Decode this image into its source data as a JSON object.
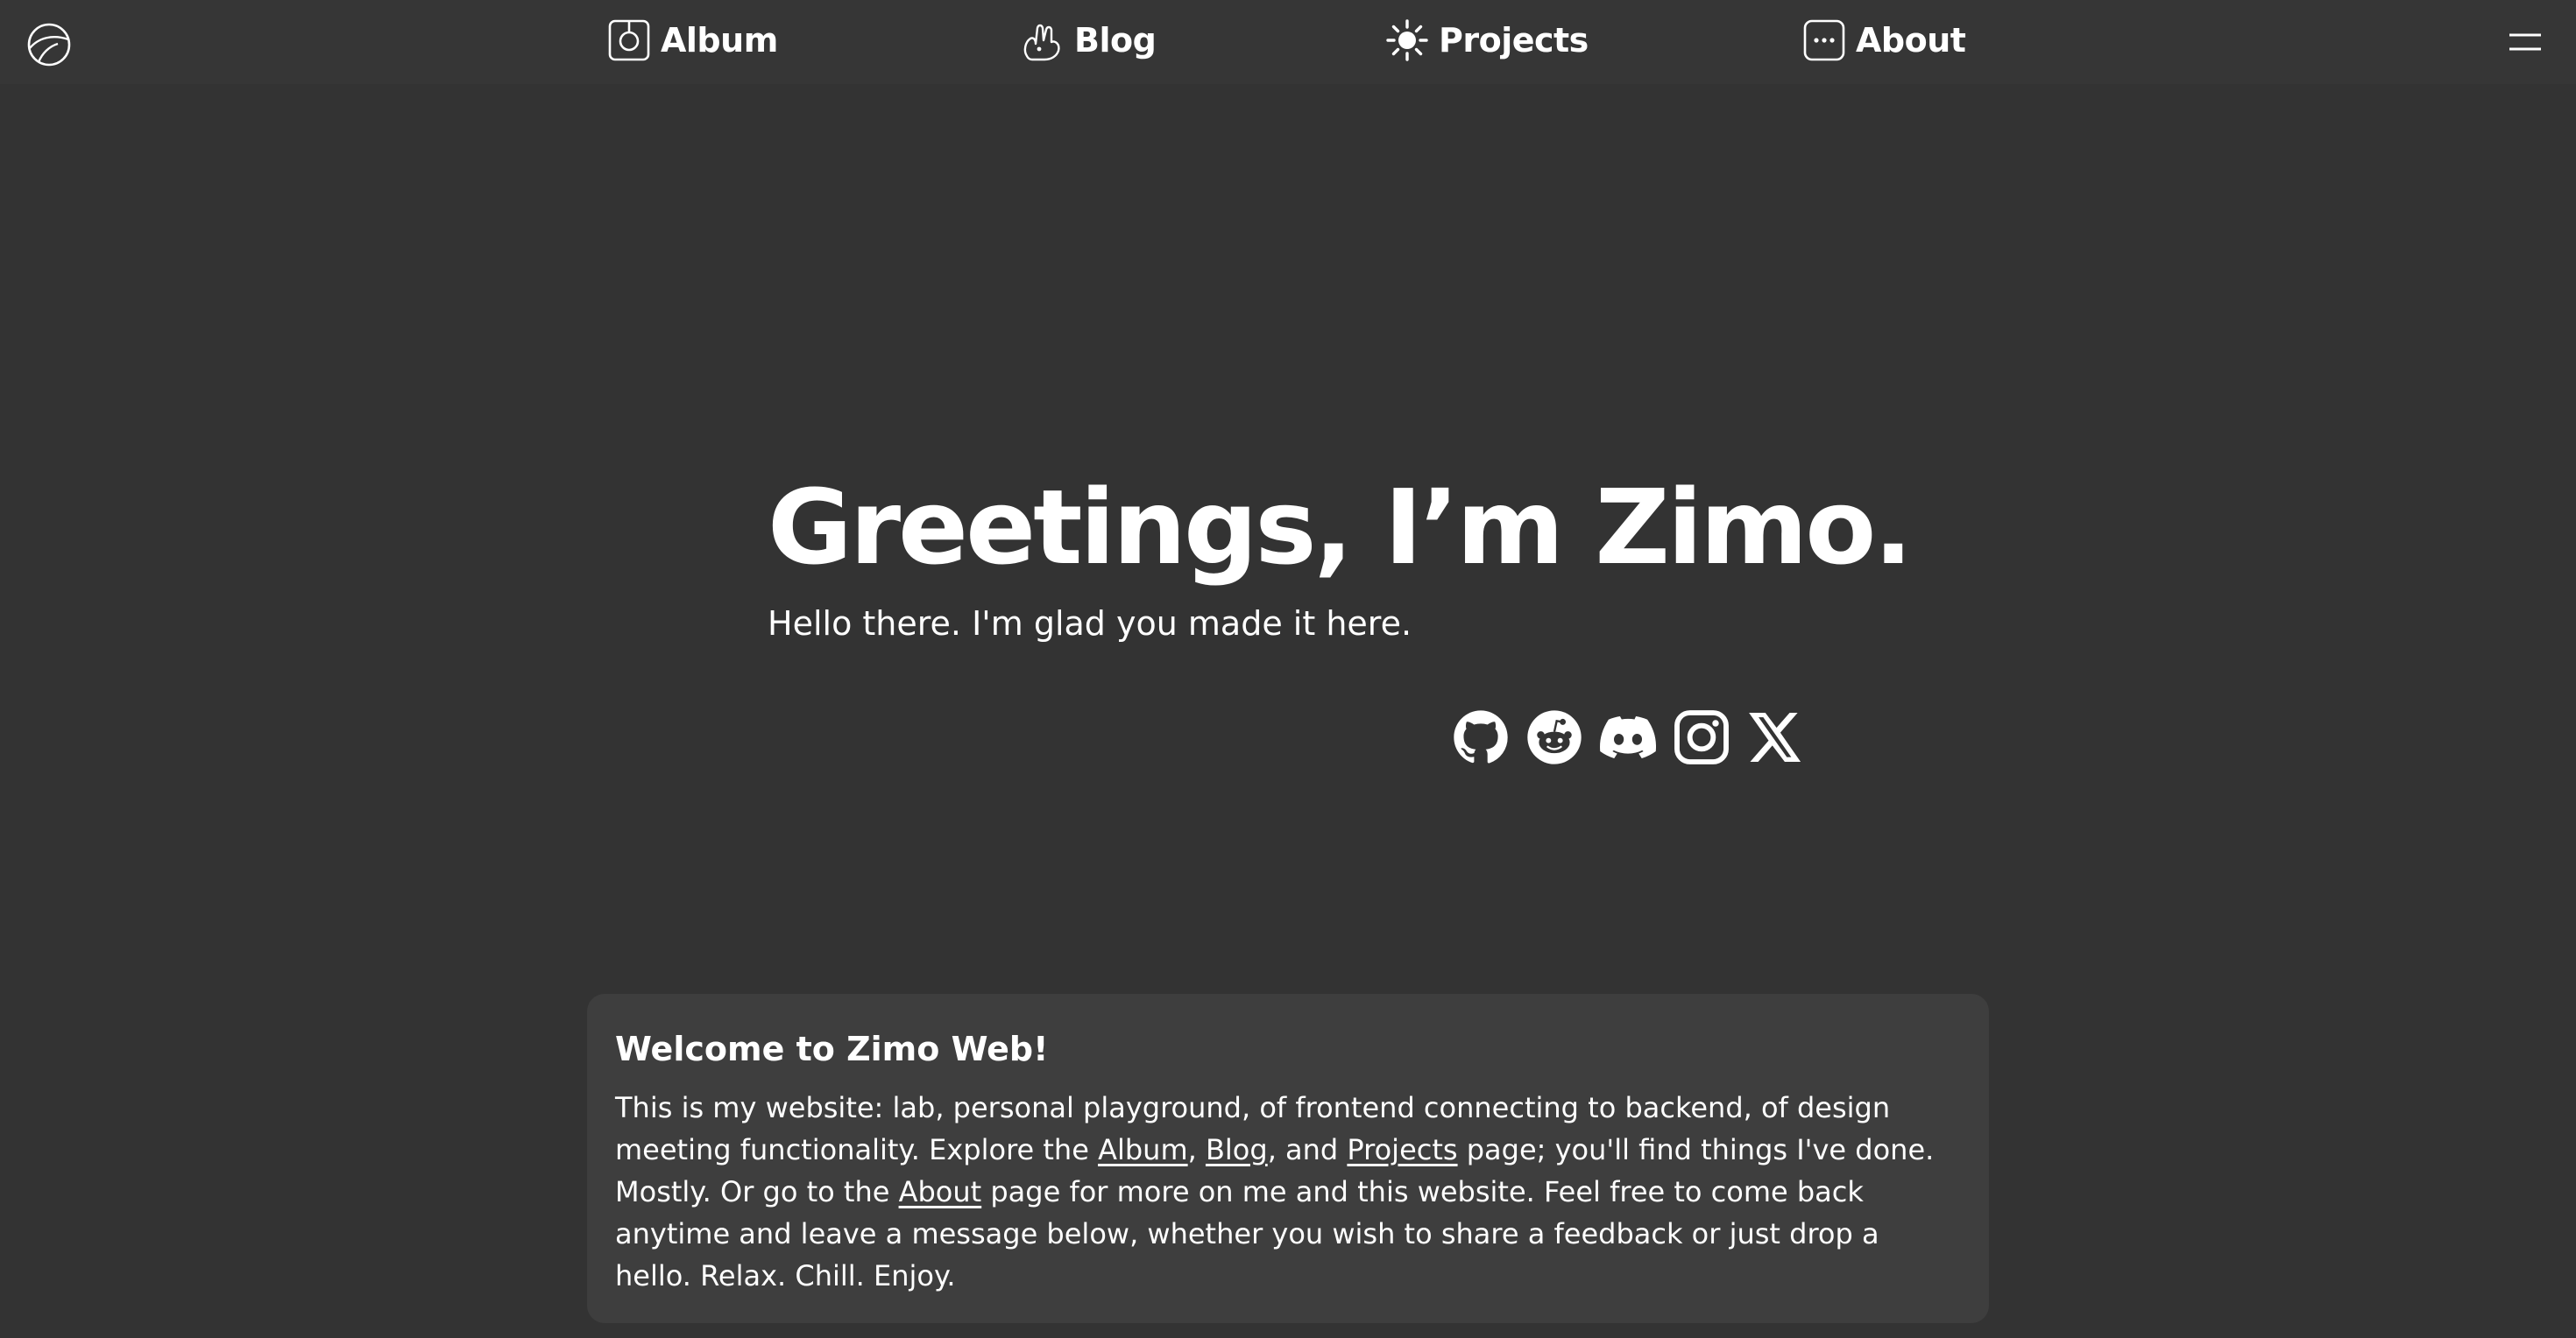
{
  "header": {
    "logo_icon": "circle-logo-icon",
    "nav": [
      {
        "label": "Album",
        "icon": "camera-icon"
      },
      {
        "label": "Blog",
        "icon": "hand-icon"
      },
      {
        "label": "Projects",
        "icon": "sun-icon"
      },
      {
        "label": "About",
        "icon": "dots-icon"
      }
    ],
    "menu_icon": "menu-icon"
  },
  "hero": {
    "title": "Greetings, I’m Zimo.",
    "subtitle": "Hello there. I'm glad you made it here."
  },
  "socials": [
    {
      "icon": "github-icon"
    },
    {
      "icon": "reddit-icon"
    },
    {
      "icon": "discord-icon"
    },
    {
      "icon": "instagram-icon"
    },
    {
      "icon": "x-icon"
    }
  ],
  "welcome": {
    "title": "Welcome to Zimo Web!",
    "text_1": "This is my website: lab, personal playground, of frontend connecting to backend, of design meeting functionality. Explore the ",
    "link_album": "Album",
    "text_2": ", ",
    "link_blog": "Blog",
    "text_3": ", and ",
    "link_projects": "Projects",
    "text_4": " page; you'll find things I've done. Mostly. Or go to the ",
    "link_about": "About",
    "text_5": " page for more on me and this website. Feel free to come back anytime and leave a message below, whether you wish to share a feedback or just drop a hello. Relax. Chill. Enjoy."
  },
  "colors": {
    "background": "#333333",
    "header_background": "#363636",
    "card_background": "#3e3e3e",
    "text": "#ffffff"
  }
}
